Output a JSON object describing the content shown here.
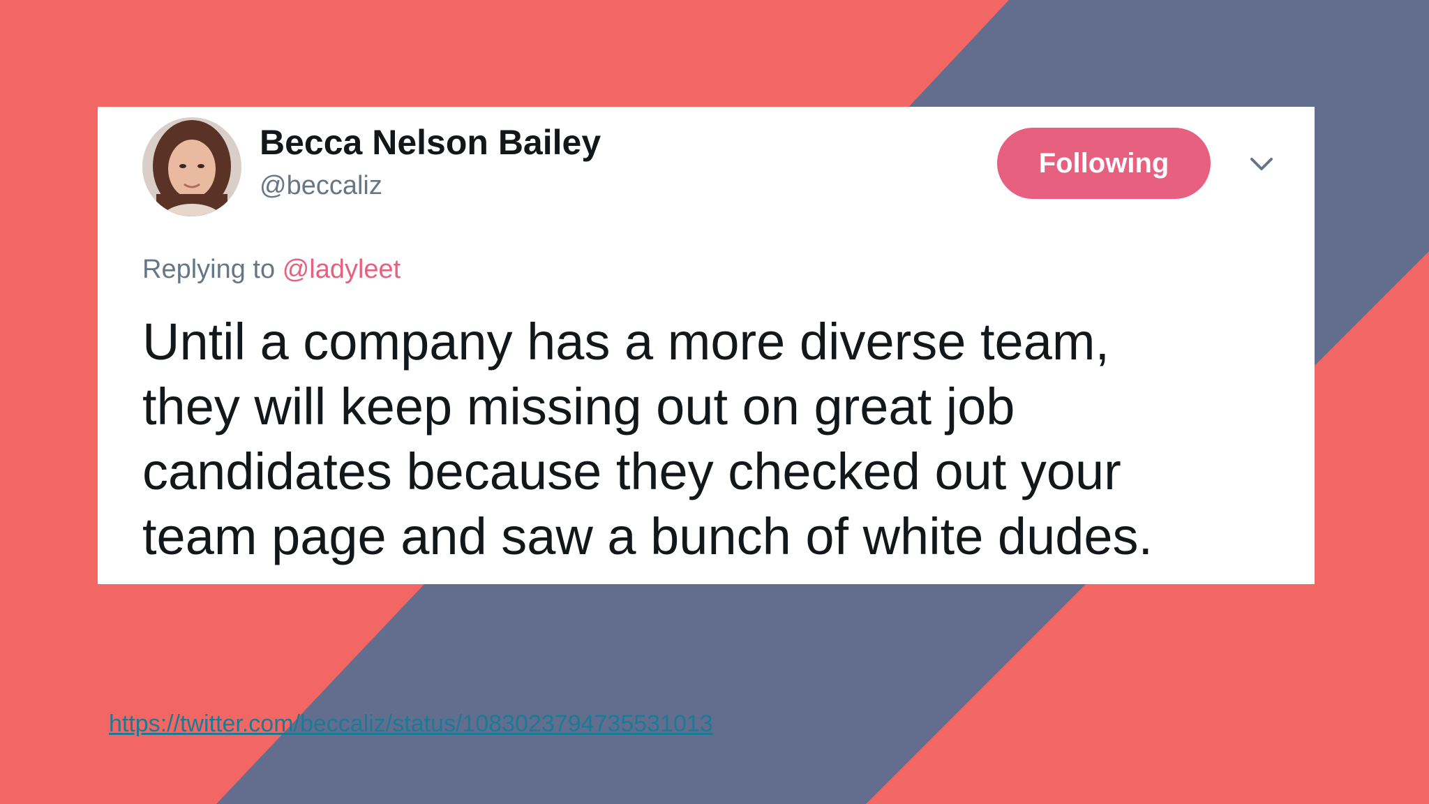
{
  "theme": {
    "coral": "#f26663",
    "slate": "#636d8e",
    "pink": "#e8607f",
    "link_teal": "#1b7a96"
  },
  "tweet": {
    "display_name": "Becca Nelson Bailey",
    "handle": "@beccaliz",
    "follow_label": "Following",
    "menu_icon": "chevron-down-icon",
    "reply_prefix": "Replying to",
    "reply_handle": "@ladyleet",
    "lines": [
      "Until a company has a more diverse team,",
      "they will keep missing out on great job",
      "candidates because they checked out your",
      "team page and saw a bunch of white dudes."
    ]
  },
  "source": {
    "url": "https://twitter.com/beccaliz/status/1083023794735531013"
  }
}
